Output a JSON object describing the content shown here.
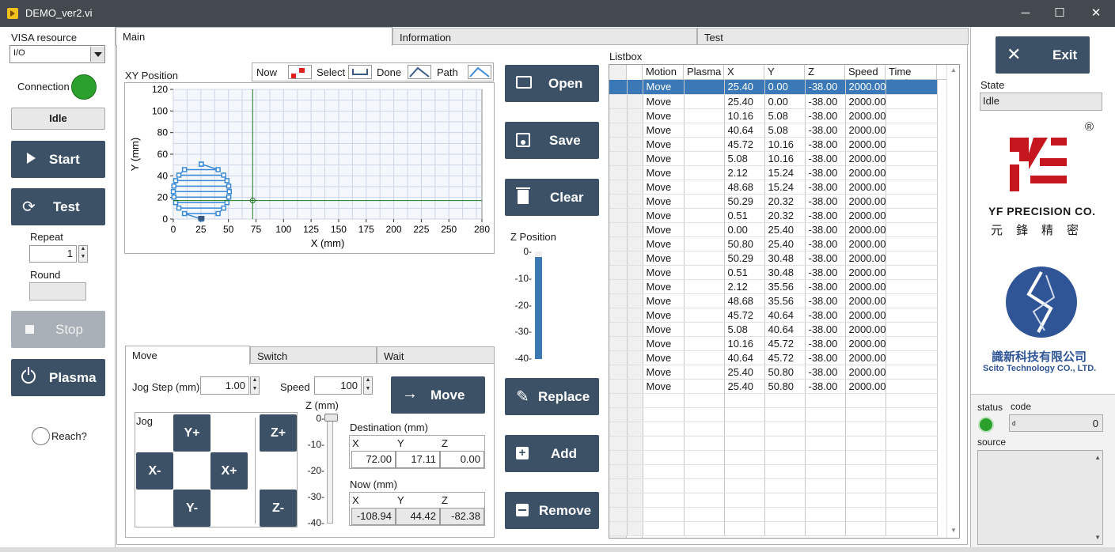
{
  "window": {
    "title": "DEMO_ver2.vi",
    "minimize": "─",
    "maximize": "☐",
    "close": "✕"
  },
  "left": {
    "visa_label": "VISA resource",
    "visa_value": "I/O",
    "connection_label": "Connection",
    "connection_color": "#2ca02c",
    "idle_label": "Idle",
    "start_label": "Start",
    "test_label": "Test",
    "repeat_label": "Repeat",
    "repeat_value": "1",
    "round_label": "Round",
    "round_value": "",
    "stop_label": "Stop",
    "plasma_label": "Plasma",
    "reach_label": "Reach?"
  },
  "tabs": {
    "main": "Main",
    "information": "Information",
    "test": "Test"
  },
  "xy": {
    "title": "XY Position",
    "legend": {
      "now": "Now",
      "select": "Select",
      "done": "Done",
      "path": "Path"
    },
    "x_label": "X (mm)",
    "y_label": "Y (mm)",
    "x_ticks": [
      "0",
      "25",
      "50",
      "75",
      "100",
      "125",
      "150",
      "175",
      "200",
      "225",
      "250",
      "280"
    ],
    "y_ticks": [
      "120",
      "100",
      "80",
      "60",
      "40",
      "20",
      "0"
    ]
  },
  "chart_data": {
    "type": "line",
    "xlabel": "X (mm)",
    "ylabel": "Y (mm)",
    "xlim": [
      0,
      280
    ],
    "ylim": [
      0,
      120
    ],
    "grid": true,
    "cursor": {
      "x": 72,
      "y": 17.11
    },
    "series": [
      {
        "name": "Path",
        "x": [
          25.4,
          25.4,
          10.16,
          40.64,
          45.72,
          5.08,
          2.12,
          48.68,
          50.29,
          0.51,
          0.0,
          50.8,
          50.29,
          0.51,
          2.12,
          48.68,
          45.72,
          5.08,
          10.16,
          40.64,
          25.4,
          25.4
        ],
        "y": [
          0.0,
          0.0,
          5.08,
          5.08,
          10.16,
          10.16,
          15.24,
          15.24,
          20.32,
          20.32,
          25.4,
          25.4,
          30.48,
          30.48,
          35.56,
          35.56,
          40.64,
          40.64,
          45.72,
          45.72,
          50.8,
          50.8
        ]
      }
    ]
  },
  "buttons": {
    "open": "Open",
    "save": "Save",
    "clear": "Clear",
    "replace": "Replace",
    "add": "Add",
    "remove": "Remove",
    "move": "Move",
    "exit": "Exit"
  },
  "zpos": {
    "title": "Z Position",
    "ticks": [
      "0",
      "-10",
      "-20",
      "-30",
      "-40"
    ],
    "level": 0.95
  },
  "subtabs": {
    "move": "Move",
    "switch": "Switch",
    "wait": "Wait"
  },
  "jogpanel": {
    "jog_step_label": "Jog Step (mm)",
    "jog_step_value": "1.00",
    "speed_label": "Speed",
    "speed_value": "100",
    "jog_label": "Jog",
    "yplus": "Y+",
    "yminus": "Y-",
    "xminus": "X-",
    "xplus": "X+",
    "zplus": "Z+",
    "zminus": "Z-",
    "z_label": "Z (mm)",
    "z_ticks": [
      "0",
      "-10",
      "-20",
      "-30",
      "-40"
    ],
    "destination_label": "Destination (mm)",
    "dest_headers": [
      "X",
      "Y",
      "Z"
    ],
    "dest_values": [
      "72.00",
      "17.11",
      "0.00"
    ],
    "now_label": "Now (mm)",
    "now_headers": [
      "X",
      "Y",
      "Z"
    ],
    "now_values": [
      "-108.94",
      "44.42",
      "-82.38"
    ]
  },
  "listbox": {
    "title": "Listbox",
    "headers": [
      "Motion",
      "Plasma",
      "X",
      "Y",
      "Z",
      "Speed",
      "Time (ms)"
    ],
    "rows": [
      [
        "Move",
        "",
        "25.40",
        "0.00",
        "-38.00",
        "2000.00",
        ""
      ],
      [
        "Move",
        "",
        "25.40",
        "0.00",
        "-38.00",
        "2000.00",
        ""
      ],
      [
        "Move",
        "",
        "10.16",
        "5.08",
        "-38.00",
        "2000.00",
        ""
      ],
      [
        "Move",
        "",
        "40.64",
        "5.08",
        "-38.00",
        "2000.00",
        ""
      ],
      [
        "Move",
        "",
        "45.72",
        "10.16",
        "-38.00",
        "2000.00",
        ""
      ],
      [
        "Move",
        "",
        "5.08",
        "10.16",
        "-38.00",
        "2000.00",
        ""
      ],
      [
        "Move",
        "",
        "2.12",
        "15.24",
        "-38.00",
        "2000.00",
        ""
      ],
      [
        "Move",
        "",
        "48.68",
        "15.24",
        "-38.00",
        "2000.00",
        ""
      ],
      [
        "Move",
        "",
        "50.29",
        "20.32",
        "-38.00",
        "2000.00",
        ""
      ],
      [
        "Move",
        "",
        "0.51",
        "20.32",
        "-38.00",
        "2000.00",
        ""
      ],
      [
        "Move",
        "",
        "0.00",
        "25.40",
        "-38.00",
        "2000.00",
        ""
      ],
      [
        "Move",
        "",
        "50.80",
        "25.40",
        "-38.00",
        "2000.00",
        ""
      ],
      [
        "Move",
        "",
        "50.29",
        "30.48",
        "-38.00",
        "2000.00",
        ""
      ],
      [
        "Move",
        "",
        "0.51",
        "30.48",
        "-38.00",
        "2000.00",
        ""
      ],
      [
        "Move",
        "",
        "2.12",
        "35.56",
        "-38.00",
        "2000.00",
        ""
      ],
      [
        "Move",
        "",
        "48.68",
        "35.56",
        "-38.00",
        "2000.00",
        ""
      ],
      [
        "Move",
        "",
        "45.72",
        "40.64",
        "-38.00",
        "2000.00",
        ""
      ],
      [
        "Move",
        "",
        "5.08",
        "40.64",
        "-38.00",
        "2000.00",
        ""
      ],
      [
        "Move",
        "",
        "10.16",
        "45.72",
        "-38.00",
        "2000.00",
        ""
      ],
      [
        "Move",
        "",
        "40.64",
        "45.72",
        "-38.00",
        "2000.00",
        ""
      ],
      [
        "Move",
        "",
        "25.40",
        "50.80",
        "-38.00",
        "2000.00",
        ""
      ],
      [
        "Move",
        "",
        "25.40",
        "50.80",
        "-38.00",
        "2000.00",
        ""
      ]
    ],
    "empty_rows": 10
  },
  "right": {
    "state_label": "State",
    "state_value": "Idle",
    "registered": "®",
    "yf_name": "YF PRECISION CO.",
    "yf_chinese": "元　鋒　精　密",
    "scito_chinese": "識新科技有限公司",
    "scito_name": "Scito Technology CO., LTD.",
    "status_label": "status",
    "code_label": "code",
    "code_prefix": "d",
    "code_value": "0",
    "source_label": "source",
    "brand_red": "#c4161c",
    "brand_blue": "#2f5597"
  }
}
